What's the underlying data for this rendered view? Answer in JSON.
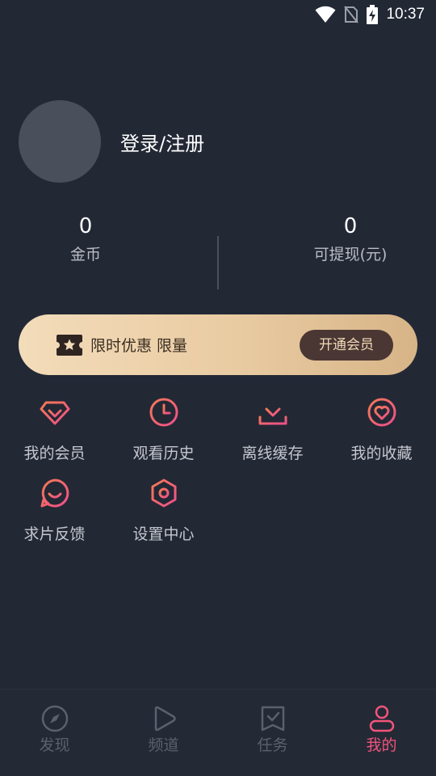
{
  "status_bar": {
    "time": "10:37"
  },
  "profile": {
    "login_label": "登录/注册"
  },
  "stats": {
    "coins": {
      "value": "0",
      "label": "金币"
    },
    "cash": {
      "value": "0",
      "label": "可提现(元)"
    }
  },
  "vip_banner": {
    "text": "限时优惠 限量",
    "button_label": "开通会员"
  },
  "menu": [
    {
      "label": "我的会员",
      "icon": "diamond-icon"
    },
    {
      "label": "观看历史",
      "icon": "clock-icon"
    },
    {
      "label": "离线缓存",
      "icon": "download-icon"
    },
    {
      "label": "我的收藏",
      "icon": "heart-icon"
    },
    {
      "label": "求片反馈",
      "icon": "feedback-icon"
    },
    {
      "label": "设置中心",
      "icon": "settings-icon"
    }
  ],
  "tabs": [
    {
      "label": "发现",
      "icon": "compass-icon"
    },
    {
      "label": "频道",
      "icon": "play-icon"
    },
    {
      "label": "任务",
      "icon": "task-icon"
    },
    {
      "label": "我的",
      "icon": "user-icon",
      "active": true
    }
  ],
  "colors": {
    "background": "#232835",
    "accent": "#f0557a",
    "icon_gradient_start": "#f26b5b",
    "icon_gradient_end": "#ee4f8a",
    "vip_gold": "#e9cba2"
  }
}
